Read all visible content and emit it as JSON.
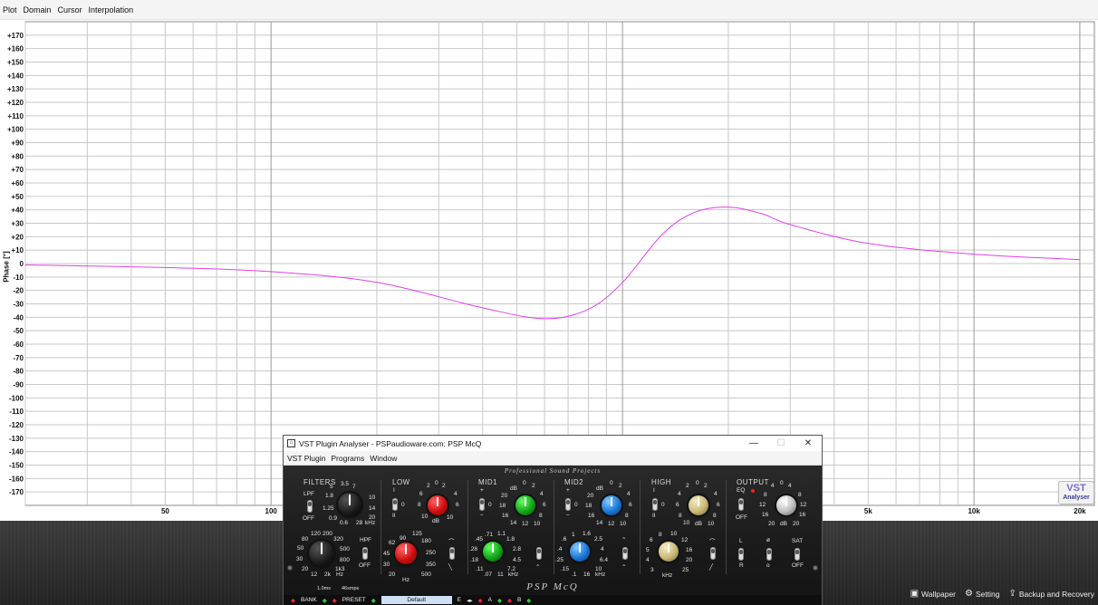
{
  "app_menu": [
    "Plot",
    "Domain",
    "Cursor",
    "Interpolation"
  ],
  "plot": {
    "y_axis_label": "Phase [°]",
    "y_ticks": [
      "+170",
      "+160",
      "+150",
      "+140",
      "+130",
      "+120",
      "+110",
      "+100",
      "+90",
      "+80",
      "+70",
      "+60",
      "+50",
      "+40",
      "+30",
      "+20",
      "+10",
      "0",
      "-10",
      "-20",
      "-30",
      "-40",
      "-50",
      "-60",
      "-70",
      "-80",
      "-90",
      "-100",
      "-110",
      "-120",
      "-130",
      "-140",
      "-150",
      "-160",
      "-170"
    ],
    "x_ticks": [
      "50",
      "100",
      "5k",
      "10k",
      "20k"
    ],
    "curve_color": "#e040e8"
  },
  "chart_data": {
    "type": "line",
    "title": "",
    "xlabel": "",
    "ylabel": "Phase [°]",
    "x_scale": "log",
    "ylim": [
      -180,
      180
    ],
    "grid": true,
    "series": [
      {
        "x": [
          20,
          50,
          100,
          200,
          400,
          600,
          800,
          1000,
          1300,
          1600,
          2000,
          2500,
          3000,
          5000,
          10000,
          20000
        ],
        "values": [
          -1,
          -3,
          -6,
          -14,
          -33,
          -41,
          -34,
          -14,
          22,
          38,
          42,
          37,
          29,
          15,
          7,
          3
        ]
      }
    ]
  },
  "logo": {
    "mark": "VST",
    "text": "Analyser"
  },
  "plugin": {
    "title": "VST Plugin Analyser - PSPaudioware.com: PSP McQ",
    "menu": [
      "VST Plugin",
      "Programs",
      "Window"
    ],
    "brand_top": "Professional Sound Projects",
    "brand_bottom": "PSP McQ",
    "sections": [
      "FILTERS",
      "LOW",
      "MID1",
      "MID2",
      "HIGH",
      "OUTPUT"
    ],
    "filters": {
      "lpf": "LPF",
      "hpf": "HPF",
      "off": "OFF",
      "lpf_scale": [
        "3.5",
        "5",
        "7",
        "2.5",
        "10",
        "1.8",
        "14",
        "1.25",
        "20",
        "0.9",
        "0.6",
        "28",
        "kHz"
      ],
      "hpf_scale": [
        "120",
        "200",
        "80",
        "320",
        "50",
        "500",
        "30",
        "800",
        "20",
        "1k3",
        "12",
        "2k",
        "Hz"
      ]
    },
    "low": {
      "gain_scale": [
        "2",
        "0",
        "2",
        "4",
        "6",
        "6",
        "8",
        "8",
        "10",
        "dB",
        "10"
      ],
      "freq_scale": [
        "90",
        "125",
        "62",
        "180",
        "45",
        "250",
        "30",
        "350",
        "20",
        "500",
        "Hz"
      ],
      "toggle_labels": [
        "I",
        "0",
        "II"
      ]
    },
    "mid1": {
      "gain_scale": [
        "dB",
        "0",
        "2",
        "20",
        "4",
        "18",
        "6",
        "16",
        "8",
        "14",
        "12",
        "10"
      ],
      "freq_scale": [
        ".71",
        "1.1",
        ".45",
        "1.8",
        ".28",
        "2.8",
        ".18",
        "4.5",
        ".11",
        "7.2",
        ".07",
        "11",
        "kHz"
      ],
      "toggle_labels": [
        "+",
        "0",
        "−"
      ]
    },
    "mid2": {
      "gain_scale": [
        "dB",
        "0",
        "2",
        "20",
        "4",
        "18",
        "6",
        "16",
        "8",
        "14",
        "12",
        "10"
      ],
      "freq_scale": [
        "1",
        "1.6",
        ".6",
        "2.5",
        ".4",
        "4",
        ".25",
        "6.4",
        ".15",
        "10",
        ".1",
        "16",
        "kHz"
      ],
      "toggle_labels": [
        "+",
        "0",
        "−"
      ]
    },
    "high": {
      "gain_scale": [
        "2",
        "0",
        "2",
        "4",
        "4",
        "6",
        "6",
        "8",
        "8",
        "10",
        "dB",
        "10"
      ],
      "freq_scale": [
        "8",
        "10",
        "6",
        "12",
        "5",
        "16",
        "4",
        "20",
        "3",
        "25",
        "kHz"
      ],
      "toggle_labels": [
        "I",
        "0",
        "II"
      ]
    },
    "output": {
      "gain_scale": [
        "4",
        "0",
        "4",
        "8",
        "8",
        "12",
        "12",
        "16",
        "16",
        "20",
        "dB",
        "20"
      ],
      "eq": "EQ",
      "off": "OFF",
      "l": "L",
      "r": "R",
      "phase": "ø",
      "o": "o",
      "sat": "SAT",
      "sat_off": "OFF"
    },
    "bottom": {
      "latency": "1.0ms",
      "samples": "46smps",
      "bank": "BANK",
      "preset": "PRESET",
      "preset_name": "Default",
      "e": "E",
      "a": "A",
      "b": "B"
    }
  },
  "taskbar": [
    {
      "icon": "wallpaper-icon",
      "label": "Wallpaper"
    },
    {
      "icon": "gear-icon",
      "label": "Setting"
    },
    {
      "icon": "backup-icon",
      "label": "Backup and Recovery"
    }
  ]
}
